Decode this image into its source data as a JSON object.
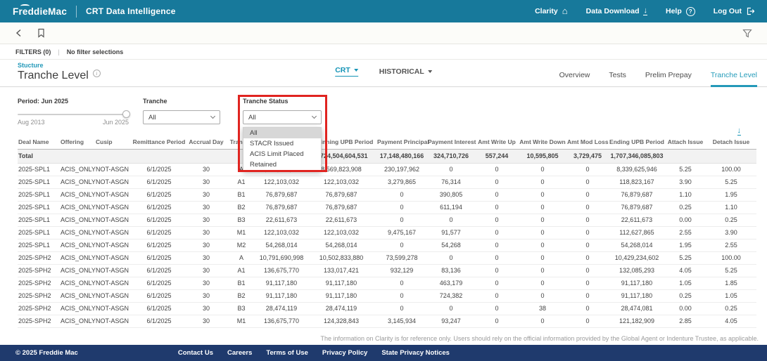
{
  "topbar": {
    "logo_text": "FreddieMac",
    "app_title": "CRT Data Intelligence",
    "nav": {
      "clarity": "Clarity",
      "data_download": "Data Download",
      "help": "Help",
      "log_out": "Log Out"
    }
  },
  "icons": {
    "back": "chevron-left",
    "bookmark": "bookmark-outline",
    "filter": "funnel",
    "clarity": "home",
    "data_download": "download-arrow",
    "help": "question-circle",
    "log_out": "exit-arrow",
    "table_download": "download-arrow",
    "page_info": "info-circle"
  },
  "filters_bar": {
    "label": "FILTERS (0)",
    "divider": "|",
    "status": "No filter selections"
  },
  "page_header": {
    "eyebrow": "Stucture",
    "title": "Tranche Level"
  },
  "scope_selectors": {
    "crt": "CRT",
    "historical": "HISTORICAL"
  },
  "tabs": [
    "Overview",
    "Tests",
    "Prelim Prepay",
    "Tranche Level"
  ],
  "active_tab": "Tranche Level",
  "controls": {
    "period": {
      "label": "Period: Jun 2025",
      "range_start": "Aug 2013",
      "range_end": "Jun 2025"
    },
    "tranche": {
      "label": "Tranche",
      "value": "All"
    },
    "tranche_status": {
      "label": "Tranche Status",
      "value": "All",
      "options": [
        "All",
        "STACR Issued",
        "ACIS Limit Placed",
        "Retained"
      ],
      "highlighted_option": "All"
    }
  },
  "table": {
    "columns": [
      "Deal Name",
      "Offering",
      "Cusip",
      "Remittance Period",
      "Accrual Day",
      "Tranche",
      "",
      "Beginning UPB Period",
      "Payment Principal",
      "Payment Interest",
      "Amt Write Up",
      "Amt Write Down",
      "Amt Mod Loss",
      "Ending UPB Period",
      "Attach Issue",
      "Detach Issue"
    ],
    "total_row": [
      "Total",
      "",
      "",
      "",
      "",
      "",
      "",
      "1,724,504,604,531",
      "17,148,480,166",
      "324,710,726",
      "557,244",
      "10,595,805",
      "3,729,475",
      "1,707,346,085,803",
      "",
      ""
    ],
    "rows": [
      [
        "2025-SPL1",
        "ACIS_ONLY",
        "NOT-ASGN",
        "6/1/2025",
        "30",
        "A",
        "8,569,823,908",
        "8,569,823,908",
        "230,197,962",
        "0",
        "0",
        "0",
        "0",
        "8,339,625,946",
        "5.25",
        "100.00"
      ],
      [
        "2025-SPL1",
        "ACIS_ONLY",
        "NOT-ASGN",
        "6/1/2025",
        "30",
        "A1",
        "122,103,032",
        "122,103,032",
        "3,279,865",
        "76,314",
        "0",
        "0",
        "0",
        "118,823,167",
        "3.90",
        "5.25"
      ],
      [
        "2025-SPL1",
        "ACIS_ONLY",
        "NOT-ASGN",
        "6/1/2025",
        "30",
        "B1",
        "76,879,687",
        "76,879,687",
        "0",
        "390,805",
        "0",
        "0",
        "0",
        "76,879,687",
        "1.10",
        "1.95"
      ],
      [
        "2025-SPL1",
        "ACIS_ONLY",
        "NOT-ASGN",
        "6/1/2025",
        "30",
        "B2",
        "76,879,687",
        "76,879,687",
        "0",
        "611,194",
        "0",
        "0",
        "0",
        "76,879,687",
        "0.25",
        "1.10"
      ],
      [
        "2025-SPL1",
        "ACIS_ONLY",
        "NOT-ASGN",
        "6/1/2025",
        "30",
        "B3",
        "22,611,673",
        "22,611,673",
        "0",
        "0",
        "0",
        "0",
        "0",
        "22,611,673",
        "0.00",
        "0.25"
      ],
      [
        "2025-SPL1",
        "ACIS_ONLY",
        "NOT-ASGN",
        "6/1/2025",
        "30",
        "M1",
        "122,103,032",
        "122,103,032",
        "9,475,167",
        "91,577",
        "0",
        "0",
        "0",
        "112,627,865",
        "2.55",
        "3.90"
      ],
      [
        "2025-SPL1",
        "ACIS_ONLY",
        "NOT-ASGN",
        "6/1/2025",
        "30",
        "M2",
        "54,268,014",
        "54,268,014",
        "0",
        "54,268",
        "0",
        "0",
        "0",
        "54,268,014",
        "1.95",
        "2.55"
      ],
      [
        "2025-SPH2",
        "ACIS_ONLY",
        "NOT-ASGN",
        "6/1/2025",
        "30",
        "A",
        "10,791,690,998",
        "10,502,833,880",
        "73,599,278",
        "0",
        "0",
        "0",
        "0",
        "10,429,234,602",
        "5.25",
        "100.00"
      ],
      [
        "2025-SPH2",
        "ACIS_ONLY",
        "NOT-ASGN",
        "6/1/2025",
        "30",
        "A1",
        "136,675,770",
        "133,017,421",
        "932,129",
        "83,136",
        "0",
        "0",
        "0",
        "132,085,293",
        "4.05",
        "5.25"
      ],
      [
        "2025-SPH2",
        "ACIS_ONLY",
        "NOT-ASGN",
        "6/1/2025",
        "30",
        "B1",
        "91,117,180",
        "91,117,180",
        "0",
        "463,179",
        "0",
        "0",
        "0",
        "91,117,180",
        "1.05",
        "1.85"
      ],
      [
        "2025-SPH2",
        "ACIS_ONLY",
        "NOT-ASGN",
        "6/1/2025",
        "30",
        "B2",
        "91,117,180",
        "91,117,180",
        "0",
        "724,382",
        "0",
        "0",
        "0",
        "91,117,180",
        "0.25",
        "1.05"
      ],
      [
        "2025-SPH2",
        "ACIS_ONLY",
        "NOT-ASGN",
        "6/1/2025",
        "30",
        "B3",
        "28,474,119",
        "28,474,119",
        "0",
        "0",
        "0",
        "38",
        "0",
        "28,474,081",
        "0.00",
        "0.25"
      ],
      [
        "2025-SPH2",
        "ACIS_ONLY",
        "NOT-ASGN",
        "6/1/2025",
        "30",
        "M1",
        "136,675,770",
        "124,328,843",
        "3,145,934",
        "93,247",
        "0",
        "0",
        "0",
        "121,182,909",
        "2.85",
        "4.05"
      ]
    ]
  },
  "disclaimer": "The information on Clarity is for reference only. Users should rely on the official information provided by the Global Agent or Indenture Trustee, as applicable.",
  "footer": {
    "copyright": "© 2025 Freddie Mac",
    "links": [
      "Contact Us",
      "Careers",
      "Terms of Use",
      "Privacy Policy",
      "State Privacy Notices"
    ]
  },
  "colors": {
    "header_teal": "#17799b",
    "footer_navy": "#1f3a6d",
    "accent_teal": "#1594b6",
    "annotation_red": "#e02420",
    "dropdown_highlight": "#d7d7d7"
  }
}
